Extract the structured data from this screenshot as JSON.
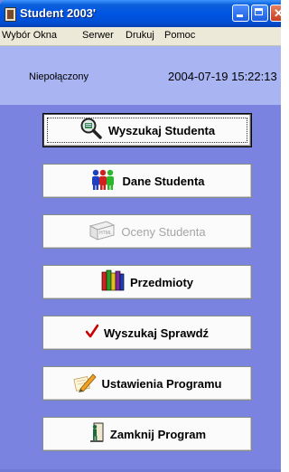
{
  "window": {
    "title": "Student 2003'"
  },
  "menu": [
    "Wybór Okna",
    "Serwer",
    "Drukuj",
    "Pomoc"
  ],
  "status": {
    "connection": "Niepołączony",
    "datetime": "2004-07-19 15:22:13"
  },
  "buttons": [
    {
      "label": "Wyszukaj Studenta",
      "icon": "magnifier-icon",
      "state": "focused"
    },
    {
      "label": "Dane Studenta",
      "icon": "people-icon",
      "state": "enabled"
    },
    {
      "label": "Oceny Studenta",
      "icon": "grades-icon",
      "state": "disabled"
    },
    {
      "label": "Przedmioty",
      "icon": "books-icon",
      "state": "enabled"
    },
    {
      "label": "Wyszukaj Sprawdź",
      "icon": "checkmark-icon",
      "state": "enabled"
    },
    {
      "label": "Ustawienia Programu",
      "icon": "pencil-icon",
      "state": "enabled"
    },
    {
      "label": "Zamknij Program",
      "icon": "exit-door-icon",
      "state": "enabled"
    }
  ],
  "colors": {
    "titlebar": "#0054e3",
    "background": "#7a84e0",
    "statusPanel": "#a9b5f2",
    "checkmark": "#cc0000"
  }
}
